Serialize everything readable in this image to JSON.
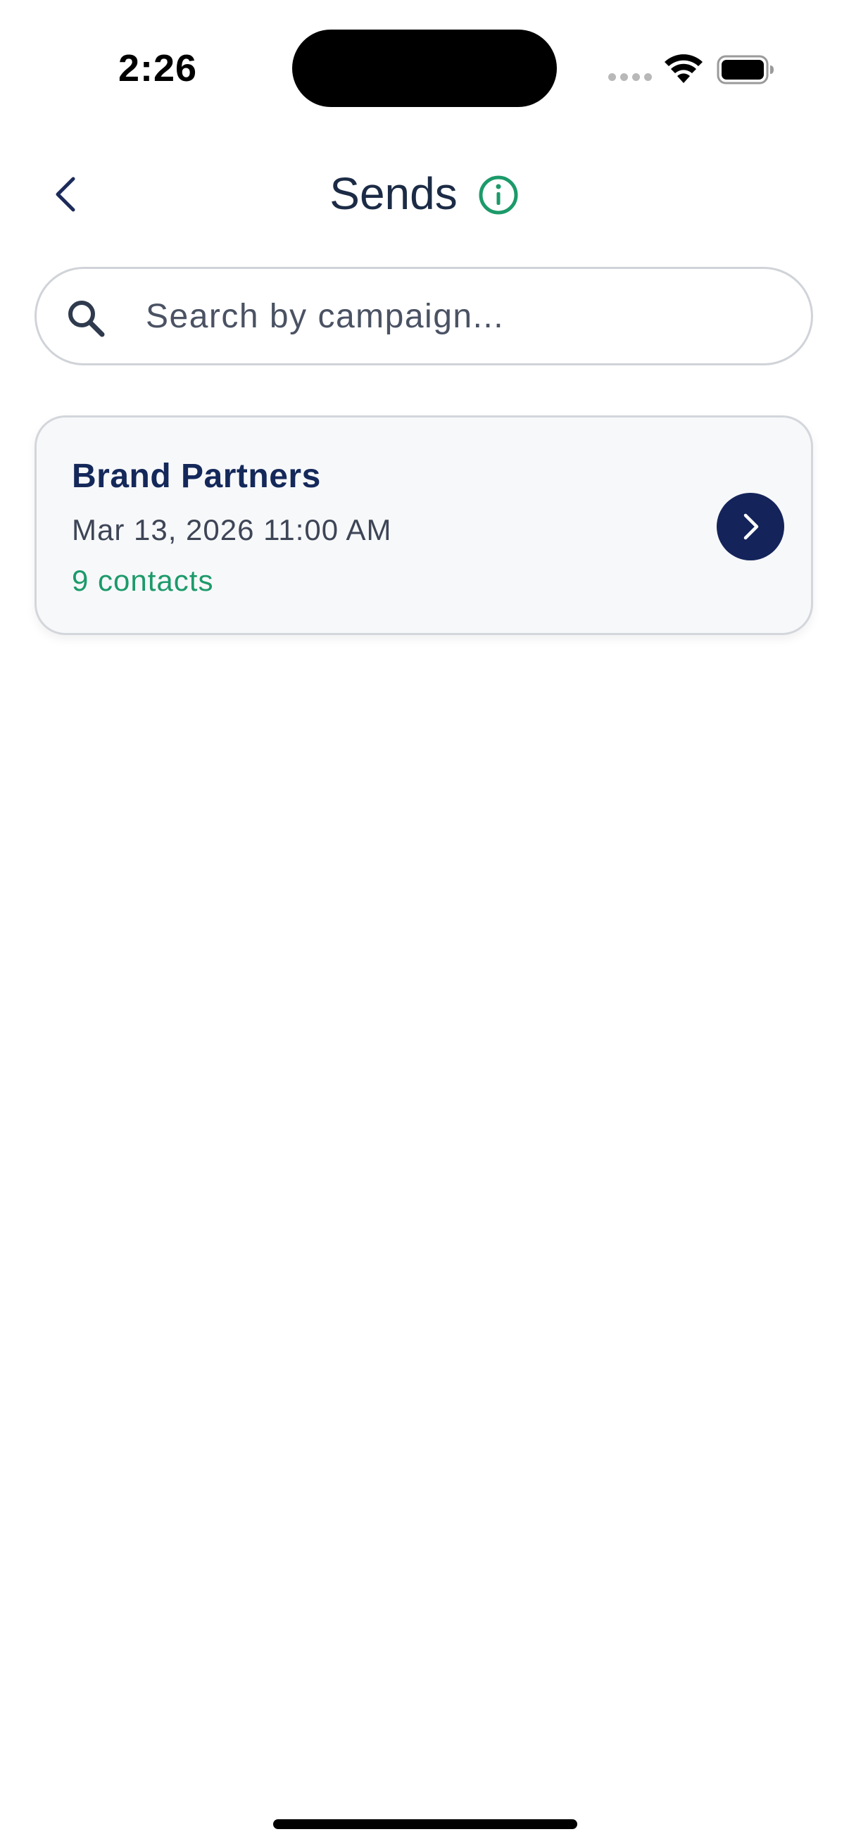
{
  "status_bar": {
    "time": "2:26"
  },
  "header": {
    "title": "Sends",
    "back_icon": "chevron-left-icon",
    "info_icon": "info-circle-icon"
  },
  "search": {
    "placeholder": "Search by campaign...",
    "value": ""
  },
  "sends": [
    {
      "campaign": "Brand Partners",
      "date": "Mar 13, 2026 11:00 AM",
      "contacts": "9 contacts"
    }
  ],
  "colors": {
    "navy": "#14245a",
    "title_text": "#1c2b45",
    "accent_green": "#1c9a6a",
    "card_bg": "#f7f8fa",
    "border": "#d0d3d8"
  }
}
